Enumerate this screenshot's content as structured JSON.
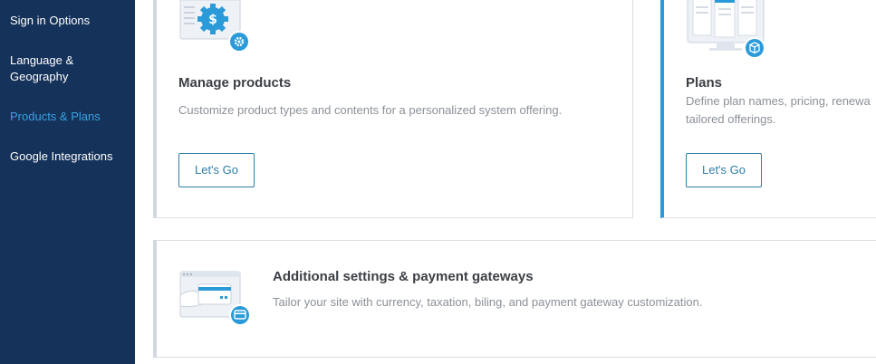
{
  "sidebar": {
    "items": [
      {
        "label": "Sign in Options",
        "active": false
      },
      {
        "label": "Language &\nGeography",
        "active": false
      },
      {
        "label": "Products & Plans",
        "active": true
      },
      {
        "label": "Google Integrations",
        "active": false
      }
    ]
  },
  "cards": {
    "manage_products": {
      "title": "Manage products",
      "description": "Customize product types and contents for a personalized system offering.",
      "button": "Let's Go"
    },
    "plans": {
      "title": "Plans",
      "description": "Define plan names, pricing, renewa tailored offerings.",
      "button": "Let's Go"
    },
    "additional": {
      "title": "Additional settings & payment gateways",
      "description": "Tailor your site with currency, taxation, biling, and payment gateway customization."
    }
  },
  "colors": {
    "sidebar_bg": "#15325a",
    "active_item": "#3aa0e0",
    "accent": "#2a9bd8",
    "button": "#2d7fa8"
  },
  "icons": {
    "manage_products": "dollar-gear-icon",
    "plans": "monitor-plans-icon",
    "additional": "card-payment-icon"
  }
}
